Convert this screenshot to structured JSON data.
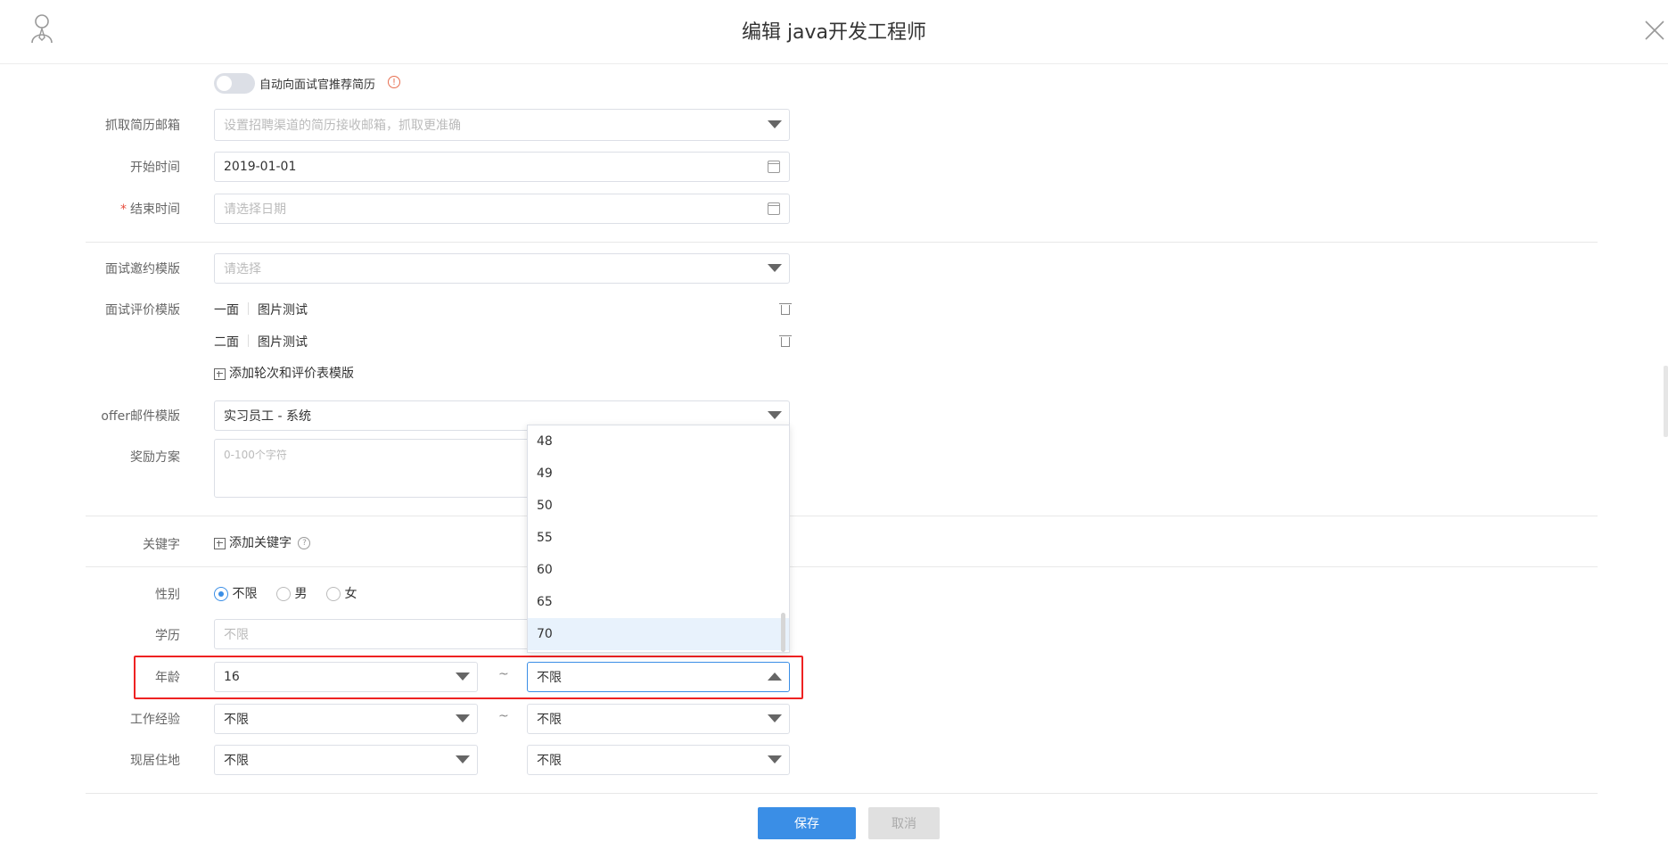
{
  "header": {
    "title": "编辑 java开发工程师"
  },
  "toggle": {
    "label": "自动向面试官推荐简历",
    "info": "!"
  },
  "form": {
    "email": {
      "label": "抓取简历邮箱",
      "placeholder": "设置招聘渠道的简历接收邮箱，抓取更准确"
    },
    "start_time": {
      "label": "开始时间",
      "value": "2019-01-01"
    },
    "end_time": {
      "label": "结束时间",
      "required": "*",
      "placeholder": "请选择日期"
    },
    "interview_invite": {
      "label": "面试邀约模版",
      "placeholder": "请选择"
    },
    "interview_eval": {
      "label": "面试评价模版",
      "rounds": [
        {
          "round": "一面",
          "template": "图片测试"
        },
        {
          "round": "二面",
          "template": "图片测试"
        }
      ],
      "add_label": "添加轮次和评价表模版"
    },
    "offer_template": {
      "label": "offer邮件模版",
      "value": "实习员工 - 系统"
    },
    "reward": {
      "label": "奖励方案",
      "placeholder": "0-100个字符"
    },
    "keyword": {
      "label": "关键字",
      "add_label": "添加关键字",
      "help": "?"
    },
    "gender": {
      "label": "性别",
      "options": [
        "不限",
        "男",
        "女"
      ],
      "selected": "不限"
    },
    "education": {
      "label": "学历",
      "placeholder": "不限"
    },
    "age": {
      "label": "年龄",
      "min": "16",
      "max": "不限",
      "sep": "~"
    },
    "experience": {
      "label": "工作经验",
      "min": "不限",
      "max": "不限",
      "sep": "~"
    },
    "residence": {
      "label": "现居住地",
      "province": "不限",
      "city": "不限"
    }
  },
  "age_dropdown": {
    "options": [
      "48",
      "49",
      "50",
      "55",
      "60",
      "65",
      "70"
    ],
    "highlighted": "70"
  },
  "footer": {
    "save_label": "保存",
    "cancel_label": "取消"
  },
  "colors": {
    "primary": "#3a8ee6",
    "highlight_border": "#ee2222",
    "required": "#e74c3c"
  }
}
